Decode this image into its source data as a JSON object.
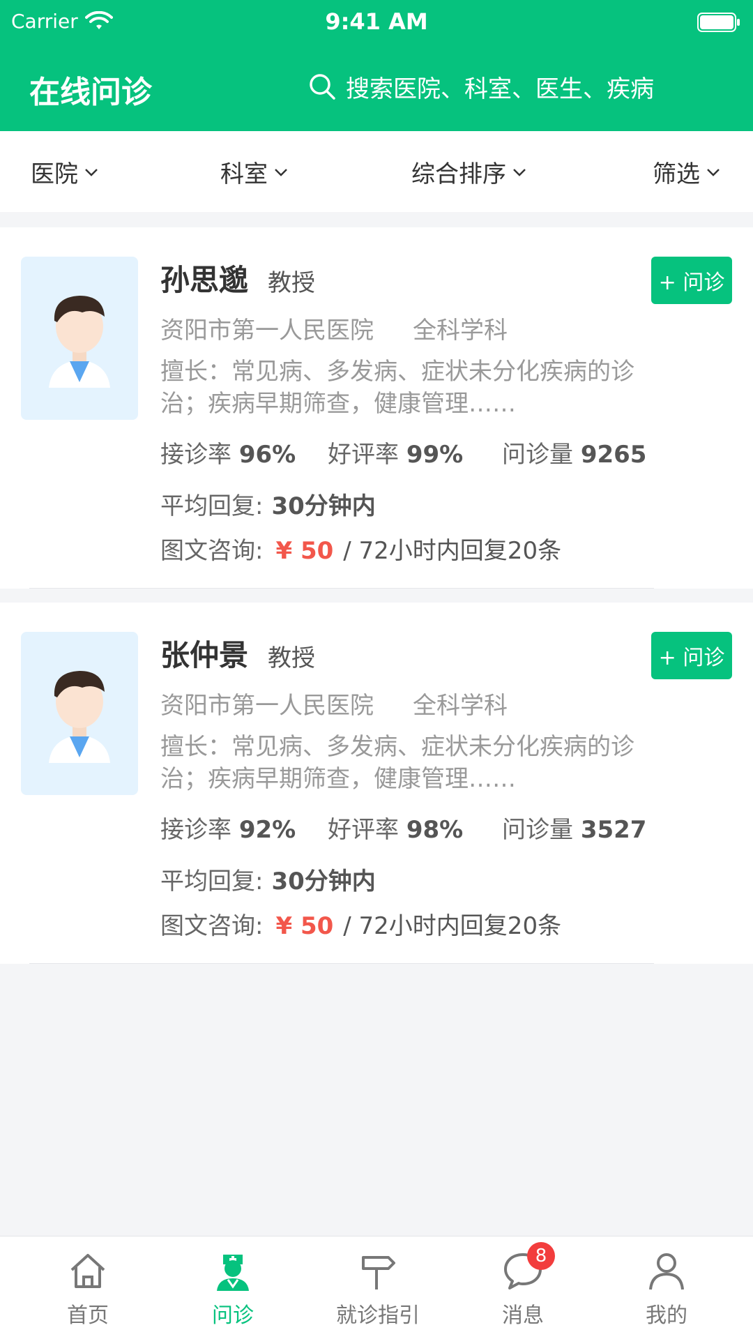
{
  "status_bar": {
    "carrier": "Carrier",
    "time": "9:41 AM"
  },
  "header": {
    "title": "在线问诊",
    "search_placeholder": "搜索医院、科室、医生、疾病"
  },
  "filters": [
    "医院",
    "科室",
    "综合排序",
    "筛选"
  ],
  "doctors": [
    {
      "name": "孙思邈",
      "title": "教授",
      "hospital": "资阳市第一人民医院",
      "department": "全科学科",
      "specialty": "擅长：常见病、多发病、症状未分化疾病的诊治；疾病早期筛查，健康管理……",
      "accept_label": "接诊率",
      "accept_rate": "96%",
      "rating_label": "好评率",
      "rating": "99%",
      "volume_label": "问诊量",
      "volume": "9265",
      "reply_label": "平均回复:",
      "reply_time": "30分钟内",
      "consult_label": "图文咨询:",
      "price": "¥ 50",
      "price_note": "/ 72小时内回复20条",
      "button": "+ 问诊"
    },
    {
      "name": "张仲景",
      "title": "教授",
      "hospital": "资阳市第一人民医院",
      "department": "全科学科",
      "specialty": "擅长：常见病、多发病、症状未分化疾病的诊治；疾病早期筛查，健康管理……",
      "accept_label": "接诊率",
      "accept_rate": "92%",
      "rating_label": "好评率",
      "rating": "98%",
      "volume_label": "问诊量",
      "volume": "3527",
      "reply_label": "平均回复:",
      "reply_time": "30分钟内",
      "consult_label": "图文咨询:",
      "price": "¥ 50",
      "price_note": "/ 72小时内回复20条",
      "button": "+ 问诊"
    }
  ],
  "tabbar": {
    "items": [
      {
        "label": "首页",
        "icon": "home-icon"
      },
      {
        "label": "问诊",
        "icon": "nurse-icon",
        "active": true
      },
      {
        "label": "就诊指引",
        "icon": "signpost-icon"
      },
      {
        "label": "消息",
        "icon": "chat-bubble-icon",
        "badge": "8"
      },
      {
        "label": "我的",
        "icon": "person-icon"
      }
    ]
  },
  "colors": {
    "primary": "#06c27e",
    "price": "#f2574b",
    "badge": "#f23d3d"
  }
}
